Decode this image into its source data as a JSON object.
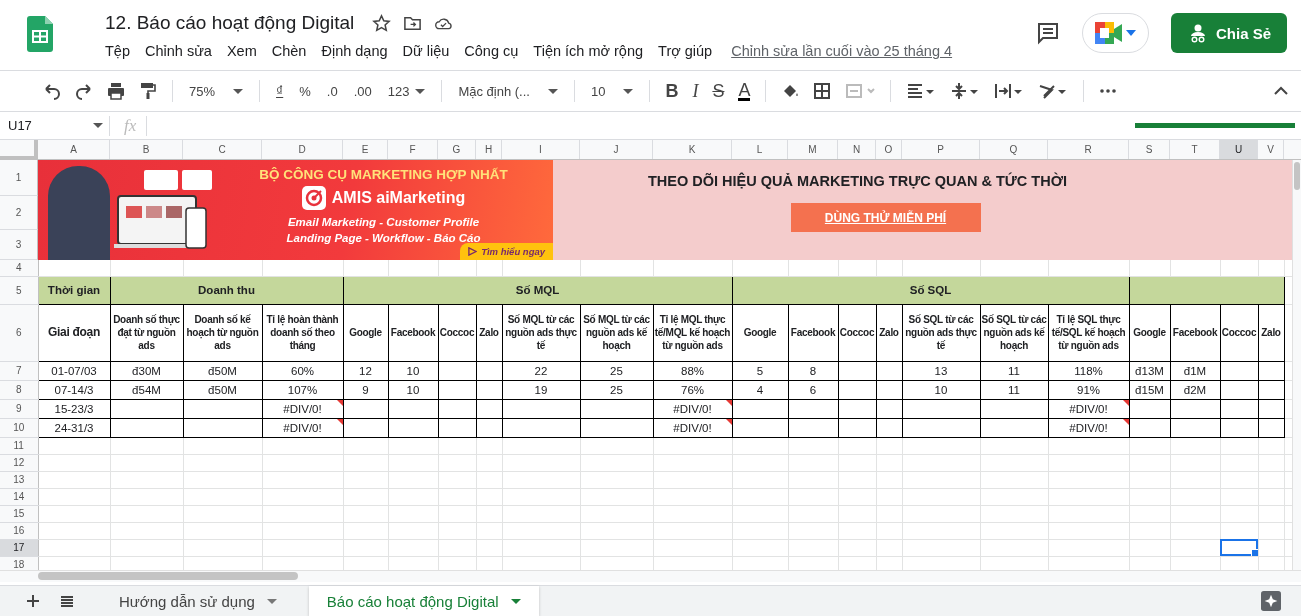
{
  "document": {
    "title": "12. Báo cáo hoạt động Digital",
    "last_edit": "Chỉnh sửa lần cuối vào 25 tháng 4"
  },
  "menu": [
    "Tệp",
    "Chỉnh sửa",
    "Xem",
    "Chèn",
    "Định dạng",
    "Dữ liệu",
    "Công cụ",
    "Tiện ích mở rộng",
    "Trợ giúp"
  ],
  "share_button": "Chia Sẻ",
  "toolbar": {
    "zoom": "75%",
    "currency": "₫",
    "percent": "%",
    "decrease_decimal": ".0",
    "increase_decimal": ".00",
    "number_format": "123",
    "font": "Mặc định (...",
    "font_size": "10",
    "bold": "B",
    "italic": "I",
    "strikethrough": "S",
    "text_color": "A"
  },
  "formula_bar": {
    "cell_reference": "U17",
    "fx": "fx"
  },
  "sheet": {
    "columns": [
      {
        "label": "A",
        "selected": false
      },
      {
        "label": "B",
        "selected": false
      },
      {
        "label": "C",
        "selected": false
      },
      {
        "label": "D",
        "selected": false
      },
      {
        "label": "E",
        "selected": false
      },
      {
        "label": "F",
        "selected": false
      },
      {
        "label": "G",
        "selected": false
      },
      {
        "label": "H",
        "selected": false
      },
      {
        "label": "I",
        "selected": false
      },
      {
        "label": "J",
        "selected": false
      },
      {
        "label": "K",
        "selected": false
      },
      {
        "label": "L",
        "selected": false
      },
      {
        "label": "M",
        "selected": false
      },
      {
        "label": "N",
        "selected": false
      },
      {
        "label": "O",
        "selected": false
      },
      {
        "label": "P",
        "selected": false
      },
      {
        "label": "Q",
        "selected": false
      },
      {
        "label": "R",
        "selected": false
      },
      {
        "label": "S",
        "selected": false
      },
      {
        "label": "T",
        "selected": false
      },
      {
        "label": "U",
        "selected": true
      },
      {
        "label": "V",
        "selected": false
      }
    ],
    "rows": [
      {
        "label": "1",
        "selected": false
      },
      {
        "label": "2",
        "selected": false
      },
      {
        "label": "3",
        "selected": false
      },
      {
        "label": "4",
        "selected": false
      },
      {
        "label": "5",
        "selected": false
      },
      {
        "label": "6",
        "selected": false
      },
      {
        "label": "7",
        "selected": false
      },
      {
        "label": "8",
        "selected": false
      },
      {
        "label": "9",
        "selected": false
      },
      {
        "label": "10",
        "selected": false
      },
      {
        "label": "11",
        "selected": false
      },
      {
        "label": "12",
        "selected": false
      },
      {
        "label": "13",
        "selected": false
      },
      {
        "label": "14",
        "selected": false
      },
      {
        "label": "15",
        "selected": false
      },
      {
        "label": "16",
        "selected": false
      },
      {
        "label": "17",
        "selected": true
      },
      {
        "label": "18",
        "selected": false
      }
    ]
  },
  "banner": {
    "headline": "BỘ CÔNG CỤ MARKETING HỢP NHẤT",
    "product": "AMIS aiMarketing",
    "line_1": "Email Marketing - Customer Profile",
    "line_2": "Landing Page - Workflow - Báo Cáo",
    "cta": "Tìm hiểu ngay"
  },
  "promo": {
    "title": "THEO DÕI HIỆU QUẢ MARKETING TRỰC QUAN & TỨC THỜI",
    "button": "DÙNG THỬ MIỄN PHÍ"
  },
  "report": {
    "groups": [
      {
        "label": "Thời gian",
        "subheaders": [
          "Giai đoạn"
        ]
      },
      {
        "label": "Doanh thu",
        "subheaders": [
          "Doanh số thực đạt từ nguồn ads",
          "Doanh số kế hoạch từ nguồn ads",
          "Tỉ lệ hoàn thành doanh số theo tháng"
        ]
      },
      {
        "label": "Số MQL",
        "subheaders": [
          "Google",
          "Facebook",
          "Coccoc",
          "Zalo",
          "Số MQL từ các nguồn ads thực tế",
          "Số MQL từ các nguồn ads kế hoạch",
          "Tỉ lệ MQL thực tế/MQL kế hoạch từ nguồn ads"
        ]
      },
      {
        "label": "Số SQL",
        "subheaders": [
          "Google",
          "Facebook",
          "Coccoc",
          "Zalo",
          "Số SQL từ các nguồn ads thực tế",
          "Số SQL từ các nguồn ads kế hoạch",
          "Tỉ lệ SQL thực tế/SQL kế hoạch từ nguồn ads"
        ]
      },
      {
        "subheaders": [
          "Google",
          "Facebook",
          "Coccoc",
          "Zalo"
        ]
      }
    ],
    "rows": [
      {
        "cells": [
          {
            "text": "01-07/03",
            "flagged": false
          },
          {
            "text": "đ30M",
            "flagged": false
          },
          {
            "text": "đ50M",
            "flagged": false
          },
          {
            "text": "60%",
            "flagged": false
          },
          {
            "text": "12",
            "flagged": false
          },
          {
            "text": "10",
            "flagged": false
          },
          null,
          null,
          {
            "text": "22",
            "flagged": false
          },
          {
            "text": "25",
            "flagged": false
          },
          {
            "text": "88%",
            "flagged": false
          },
          {
            "text": "5",
            "flagged": false
          },
          {
            "text": "8",
            "flagged": false
          },
          null,
          null,
          {
            "text": "13",
            "flagged": false
          },
          {
            "text": "11",
            "flagged": false
          },
          {
            "text": "118%",
            "flagged": false
          },
          {
            "text": "đ13M",
            "flagged": false
          },
          {
            "text": "đ1M",
            "flagged": false
          },
          null,
          null
        ]
      },
      {
        "cells": [
          {
            "text": "07-14/3",
            "flagged": false
          },
          {
            "text": "đ54M",
            "flagged": false
          },
          {
            "text": "đ50M",
            "flagged": false
          },
          {
            "text": "107%",
            "flagged": false
          },
          {
            "text": "9",
            "flagged": false
          },
          {
            "text": "10",
            "flagged": false
          },
          null,
          null,
          {
            "text": "19",
            "flagged": false
          },
          {
            "text": "25",
            "flagged": false
          },
          {
            "text": "76%",
            "flagged": false
          },
          {
            "text": "4",
            "flagged": false
          },
          {
            "text": "6",
            "flagged": false
          },
          null,
          null,
          {
            "text": "10",
            "flagged": false
          },
          {
            "text": "11",
            "flagged": false
          },
          {
            "text": "91%",
            "flagged": false
          },
          {
            "text": "đ15M",
            "flagged": false
          },
          {
            "text": "đ2M",
            "flagged": false
          },
          null,
          null
        ]
      },
      {
        "cells": [
          {
            "text": "15-23/3",
            "flagged": false
          },
          null,
          null,
          {
            "text": "#DIV/0!",
            "flagged": true
          },
          null,
          null,
          null,
          null,
          null,
          null,
          {
            "text": "#DIV/0!",
            "flagged": true
          },
          null,
          null,
          null,
          null,
          null,
          null,
          {
            "text": "#DIV/0!",
            "flagged": true
          },
          null,
          null,
          null,
          null
        ]
      },
      {
        "cells": [
          {
            "text": "24-31/3",
            "flagged": false
          },
          null,
          null,
          {
            "text": "#DIV/0!",
            "flagged": true
          },
          null,
          null,
          null,
          null,
          null,
          null,
          {
            "text": "#DIV/0!",
            "flagged": true
          },
          null,
          null,
          null,
          null,
          null,
          null,
          {
            "text": "#DIV/0!",
            "flagged": true
          },
          null,
          null,
          null,
          null
        ]
      }
    ]
  },
  "sheet_tabs": [
    {
      "label": "Hướng dẫn sử dụng",
      "selected": false
    },
    {
      "label": "Báo cáo hoạt động Digital",
      "selected": true
    }
  ]
}
